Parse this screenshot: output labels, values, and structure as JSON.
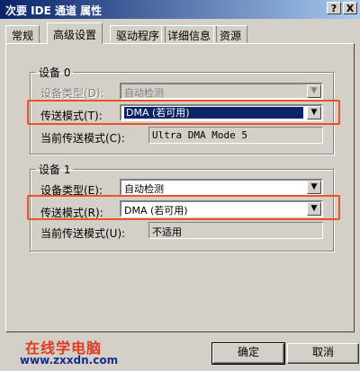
{
  "window": {
    "title": "次要 IDE 通道 属性",
    "help_glyph": "?",
    "close_glyph": "X"
  },
  "tabs": [
    {
      "label": "常规"
    },
    {
      "label": "高级设置",
      "active": true
    },
    {
      "label": "驱动程序"
    },
    {
      "label": "详细信息"
    },
    {
      "label": "资源"
    }
  ],
  "device0": {
    "legend": "设备 0",
    "type_label": "设备类型(D):",
    "type_value": "自动检测",
    "type_disabled": true,
    "mode_label": "传送模式(T):",
    "mode_value": "DMA (若可用)",
    "mode_selected": true,
    "current_label": "当前传送模式(C):",
    "current_value": "Ultra DMA Mode 5"
  },
  "device1": {
    "legend": "设备 1",
    "type_label": "设备类型(E):",
    "type_value": "自动检测",
    "mode_label": "传送模式(R):",
    "mode_value": "DMA (若可用)",
    "current_label": "当前传送模式(U):",
    "current_value": "不适用"
  },
  "buttons": {
    "ok": "确定",
    "cancel": "取消"
  },
  "watermark": {
    "line1": "在线学电脑",
    "line2": "www.zxxdn.com"
  },
  "colors": {
    "highlight": "#e8542a",
    "titlebar": "#0a246a",
    "selection": "#0a246a"
  },
  "icons": {
    "combo_arrow": "chevron-down-icon"
  }
}
